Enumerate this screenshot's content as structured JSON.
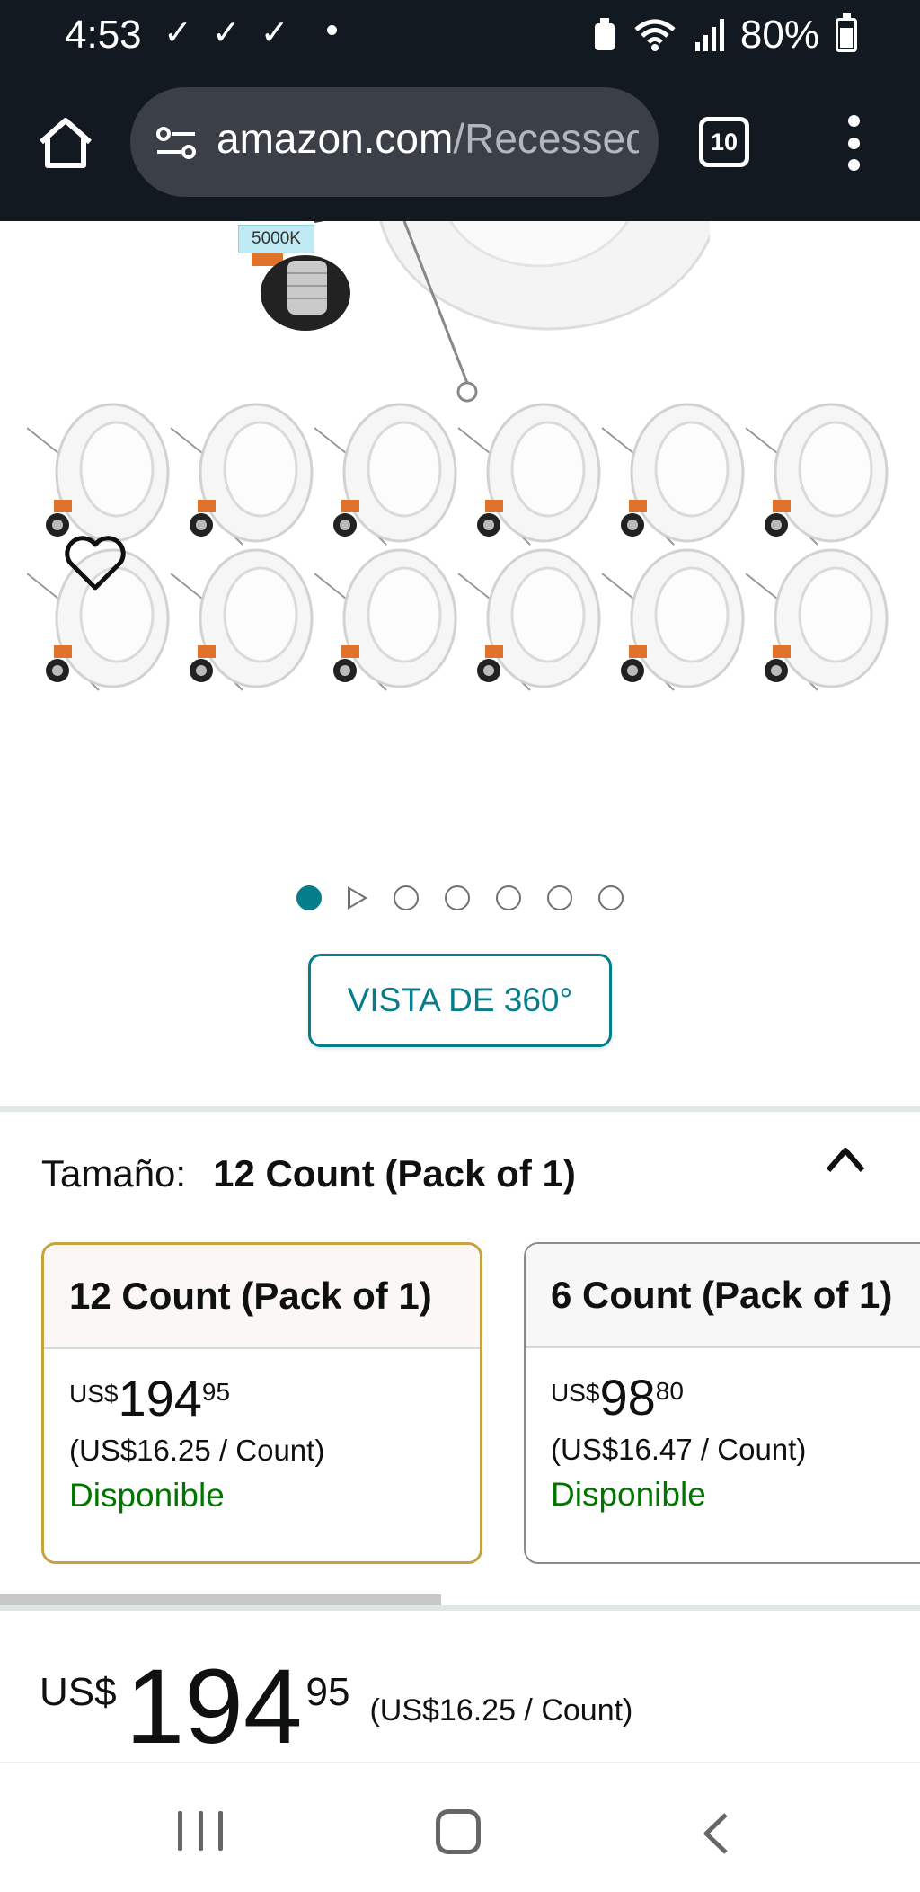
{
  "status_bar": {
    "time": "4:53",
    "checks": [
      "✓",
      "✓",
      "✓"
    ],
    "battery": "80%"
  },
  "browser": {
    "url_host": "amazon.com",
    "url_path": "/Recessed",
    "tab_count": "10"
  },
  "gallery": {
    "kelvin_tag": "5000K",
    "dot_count": 7,
    "active_dot": 0
  },
  "view360_label": "VISTA DE 360°",
  "size_section": {
    "label": "Tamaño:",
    "selected": "12 Count (Pack of 1)"
  },
  "size_options": [
    {
      "name": "12 Count (Pack of 1)",
      "currency": "US$",
      "whole": "194",
      "fraction": "95",
      "unit_price": "(US$16.25 / Count)",
      "availability": "Disponible"
    },
    {
      "name": "6 Count (Pack of 1)",
      "currency": "US$",
      "whole": "98",
      "fraction": "80",
      "unit_price": "(US$16.47 / Count)",
      "availability": "Disponible"
    }
  ],
  "main_price": {
    "currency": "US$",
    "whole": "194",
    "fraction": "95",
    "unit_price": "(US$16.25 / Count)"
  },
  "colors": {
    "accent_teal": "#067d8b",
    "available_green": "#007600",
    "selected_border": "#c6a242",
    "topbar": "#131921"
  }
}
